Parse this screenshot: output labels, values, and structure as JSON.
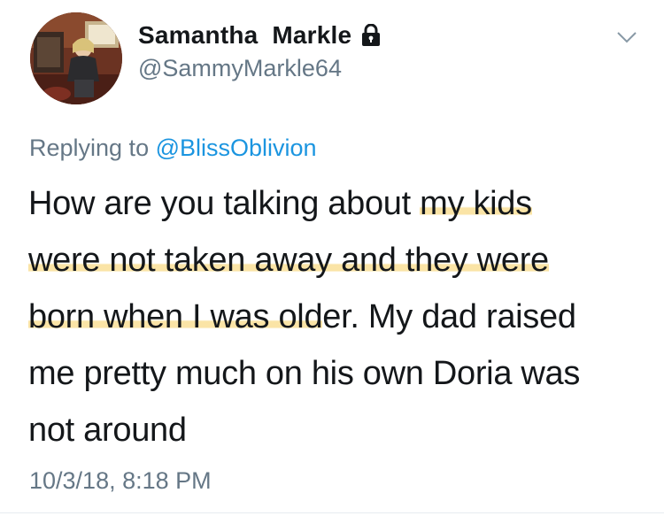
{
  "user": {
    "display_name": "Samantha  Markle",
    "handle": "@SammyMarkle64",
    "protected": true
  },
  "reply": {
    "prefix": "Replying to",
    "mention": "@BlissOblivion"
  },
  "tweet": {
    "lines": [
      {
        "plain": "How are you talking about ",
        "highlight": "my kids",
        "rest": ""
      },
      {
        "plain": "",
        "highlight": "were not taken away and they were",
        "rest": ""
      },
      {
        "plain": "",
        "highlight": "born when I was old",
        "rest": "er. My dad raised"
      },
      {
        "plain": "me pretty much on his own Doria was",
        "highlight": "",
        "rest": ""
      },
      {
        "plain": "not around",
        "highlight": "",
        "rest": ""
      }
    ]
  },
  "timestamp": "10/3/18, 8:18 PM",
  "icons": {
    "lock": "lock-icon",
    "caret": "chevron-down-icon",
    "avatar": "avatar"
  },
  "colors": {
    "name": "#14171a",
    "secondary": "#657786",
    "link": "#1b95e0",
    "highlight": "#f7ce5c"
  }
}
